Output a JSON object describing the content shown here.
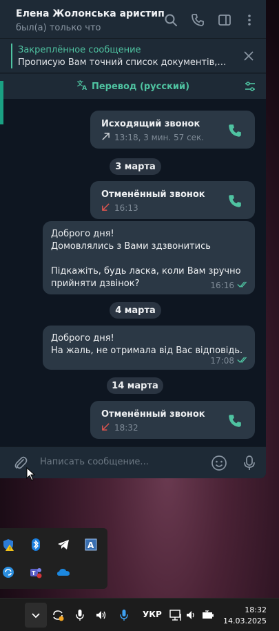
{
  "header": {
    "title": "Елена Жолонська аристип",
    "status": "был(а) только что",
    "icons": [
      "search-icon",
      "phone-icon",
      "sidebar-toggle-icon",
      "more-vertical-icon"
    ]
  },
  "pinned": {
    "title": "Закреплённое сообщение",
    "text": "Прописую Вам точний список документів, ори..."
  },
  "translate": {
    "label": "Перевод (русский)"
  },
  "messages": {
    "call1": {
      "title": "Исходящий звонок",
      "meta": "13:18, 3 мин. 57 сек."
    },
    "date1": "3 марта",
    "call2": {
      "title": "Отменённый звонок",
      "meta": "16:13"
    },
    "msg1": {
      "text": "Доброго дня!\nДомовлялись з Вами здзвонитись\n\nПідкажіть, будь ласка, коли Вам зручно прийняти дзвінок?",
      "time": "16:16"
    },
    "date2": "4 марта",
    "msg2": {
      "text": "Доброго дня!\nНа жаль, не отримала від Вас відповідь.",
      "time": "17:08"
    },
    "date3": "14 марта",
    "call3": {
      "title": "Отменённый звонок",
      "meta": "18:32"
    }
  },
  "composer": {
    "placeholder": "Написать сообщение..."
  },
  "taskbar": {
    "language": "УКР",
    "time": "18:32",
    "date": "14.03.2025"
  },
  "colors": {
    "accent": "#4fc3a1",
    "missed_call": "#e0554f",
    "bubble": "#2a3441",
    "chat_bg": "#0e1621"
  }
}
